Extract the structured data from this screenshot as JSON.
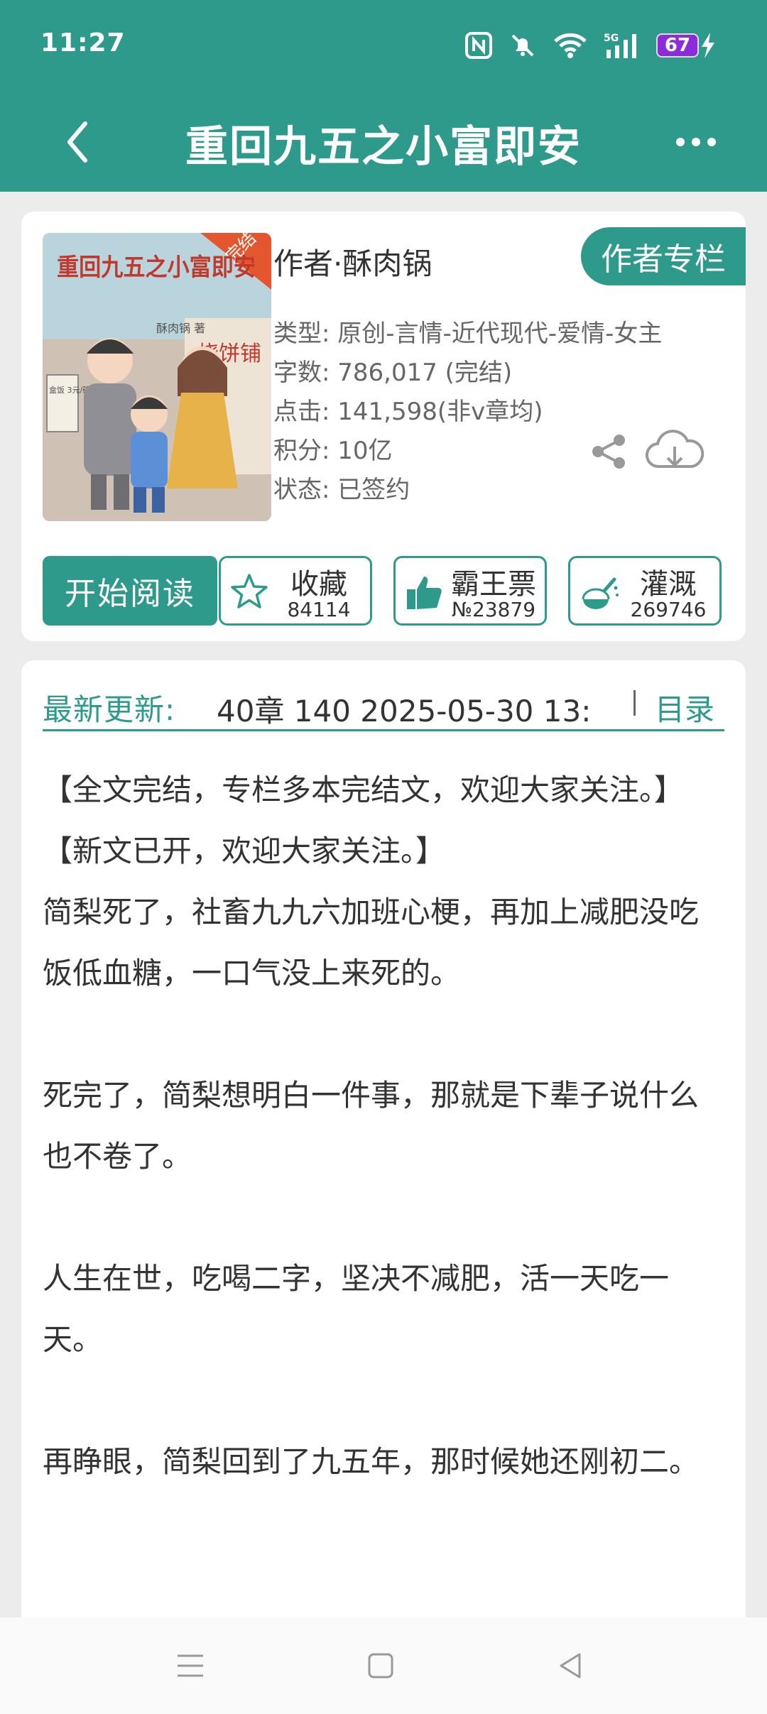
{
  "status_bar": {
    "time": "11:27",
    "battery": "67",
    "network": "5G"
  },
  "header": {
    "title": "重回九五之小富即安"
  },
  "book": {
    "author": "作者·酥肉锅",
    "author_column_label": "作者专栏",
    "cover": {
      "title_art": "重回九五之小富即安",
      "badge": "完结",
      "shop_sign": "烧饼铺",
      "author_mark": "酥肉锅 著",
      "signboard": "盒饭 3元/碗"
    },
    "meta": [
      "类型: 原创-言情-近代现代-爱情-女主",
      "字数: 786,017 (完结)",
      "点击: 141,598(非v章均)",
      "积分: 10亿",
      "状态: 已签约"
    ]
  },
  "actions": {
    "read_label": "开始阅读",
    "favorite": {
      "label": "收藏",
      "count": "84114"
    },
    "vote": {
      "label": "霸王票",
      "count": "№23879"
    },
    "nutrient": {
      "label": "灌溉",
      "count": "269746"
    }
  },
  "latest": {
    "label": "最新更新:",
    "text": "40章  140  2025-05-30 13:",
    "toc_label": "目录"
  },
  "summary": [
    "【全文完结，专栏多本完结文，欢迎大家关注。】【新文已开，欢迎大家关注。】",
    "简梨死了，社畜九九六加班心梗，再加上减肥没吃饭低血糖，一口气没上来死的。",
    "",
    "死完了，简梨想明白一件事，那就是下辈子说什么也不卷了。",
    "",
    "人生在世，吃喝二字，坚决不减肥，活一天吃一天。",
    "",
    "再睁眼，简梨回到了九五年，那时候她还刚初二。"
  ],
  "colors": {
    "accent": "#2e9a8c",
    "background": "#ececec"
  }
}
